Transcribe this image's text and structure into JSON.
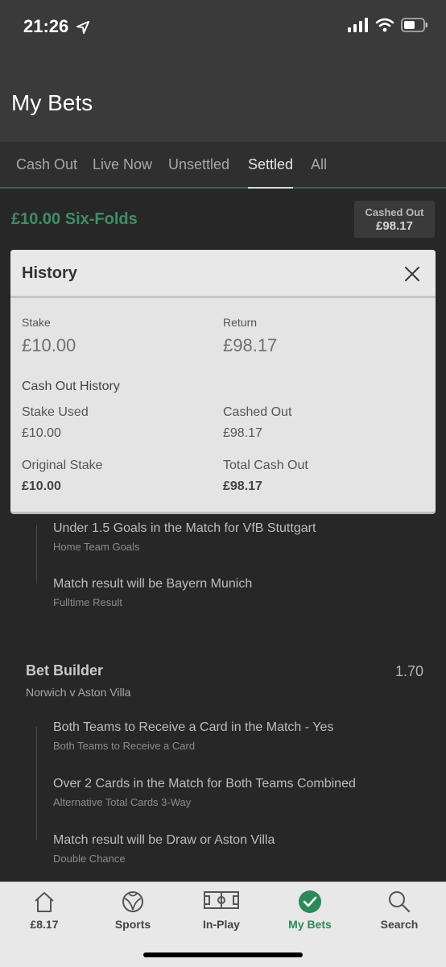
{
  "status_bar": {
    "time": "21:26"
  },
  "header": {
    "title": "My Bets"
  },
  "tabs": [
    {
      "label": "Cash Out"
    },
    {
      "label": "Live Now"
    },
    {
      "label": "Unsettled"
    },
    {
      "label": "Settled",
      "active": true
    },
    {
      "label": "All"
    }
  ],
  "bet": {
    "title": "£10.00 Six-Folds",
    "badge_label": "Cashed Out",
    "badge_value": "£98.17"
  },
  "history": {
    "title": "History",
    "stake_label": "Stake",
    "stake_value": "£10.00",
    "return_label": "Return",
    "return_value": "£98.17",
    "section_title": "Cash Out History",
    "stake_used_label": "Stake Used",
    "stake_used_value": "£10.00",
    "cashed_out_label": "Cashed Out",
    "cashed_out_value": "£98.17",
    "original_stake_label": "Original Stake",
    "original_stake_value": "£10.00",
    "total_cash_out_label": "Total Cash Out",
    "total_cash_out_value": "£98.17"
  },
  "selections_top": [
    {
      "name": "Under 1.5 Goals in the Match for VfB Stuttgart",
      "market": "Home Team Goals"
    },
    {
      "name": "Match result will be Bayern Munich",
      "market": "Fulltime Result"
    }
  ],
  "bet_builder": {
    "title": "Bet Builder",
    "odds": "1.70",
    "match": "Norwich v Aston Villa",
    "selections": [
      {
        "name": "Both Teams to Receive a Card in the Match - Yes",
        "market": "Both Teams to Receive a Card"
      },
      {
        "name": "Over 2 Cards in the Match for Both Teams Combined",
        "market": "Alternative Total Cards 3-Way"
      },
      {
        "name": "Match result will be Draw or Aston Villa",
        "market": "Double Chance"
      }
    ]
  },
  "bottom_nav": [
    {
      "label": "£8.17",
      "icon": "home-icon"
    },
    {
      "label": "Sports",
      "icon": "football-icon"
    },
    {
      "label": "In-Play",
      "icon": "pitch-icon"
    },
    {
      "label": "My Bets",
      "icon": "check-circle-icon",
      "active": true
    },
    {
      "label": "Search",
      "icon": "search-icon"
    }
  ],
  "colors": {
    "accent": "#2d8a58",
    "bet_title": "#3d8f63"
  }
}
